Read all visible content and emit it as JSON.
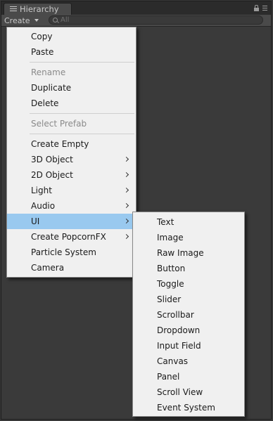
{
  "window": {
    "tab_title": "Hierarchy"
  },
  "toolbar": {
    "create_label": "Create",
    "search_placeholder": "All"
  },
  "create_menu": {
    "items": [
      {
        "label": "Copy"
      },
      {
        "label": "Paste"
      },
      {
        "label": "Rename",
        "disabled": true
      },
      {
        "label": "Duplicate"
      },
      {
        "label": "Delete"
      },
      {
        "label": "Select Prefab",
        "disabled": true
      },
      {
        "label": "Create Empty"
      },
      {
        "label": "3D Object",
        "submenu": true
      },
      {
        "label": "2D Object",
        "submenu": true
      },
      {
        "label": "Light",
        "submenu": true
      },
      {
        "label": "Audio",
        "submenu": true
      },
      {
        "label": "UI",
        "submenu": true,
        "highlighted": true
      },
      {
        "label": "Create PopcornFX",
        "submenu": true
      },
      {
        "label": "Particle System"
      },
      {
        "label": "Camera"
      }
    ]
  },
  "ui_submenu": {
    "items": [
      {
        "label": "Text"
      },
      {
        "label": "Image"
      },
      {
        "label": "Raw Image"
      },
      {
        "label": "Button"
      },
      {
        "label": "Toggle"
      },
      {
        "label": "Slider"
      },
      {
        "label": "Scrollbar"
      },
      {
        "label": "Dropdown"
      },
      {
        "label": "Input Field"
      },
      {
        "label": "Canvas"
      },
      {
        "label": "Panel"
      },
      {
        "label": "Scroll View"
      },
      {
        "label": "Event System"
      }
    ]
  },
  "colors": {
    "highlight": "#99c9ef",
    "menu_bg": "#f0f0f0",
    "editor_bg": "#3a3a3a"
  }
}
